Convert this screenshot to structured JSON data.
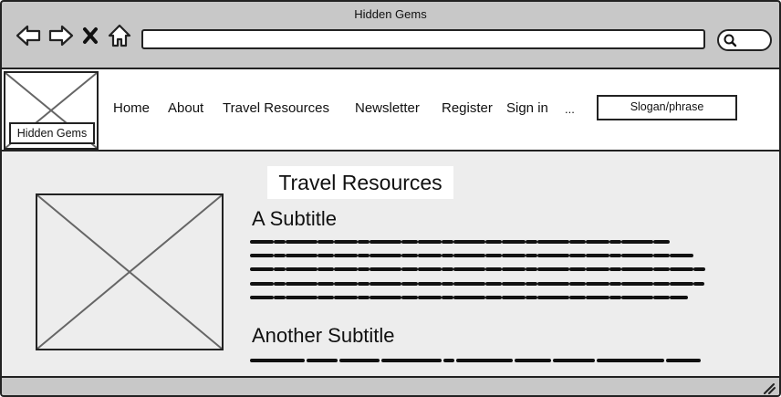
{
  "window": {
    "title": "Hidden Gems"
  },
  "toolbar": {
    "icons": [
      "back-arrow-icon",
      "forward-arrow-icon",
      "close-x-icon",
      "home-icon",
      "search-icon"
    ],
    "url_value": ""
  },
  "site": {
    "logo_label": "Hidden Gems",
    "nav": [
      {
        "label": "Home"
      },
      {
        "label": "About"
      },
      {
        "label": "Travel Resources"
      },
      {
        "label": "Newsletter"
      },
      {
        "label": "Register"
      },
      {
        "label": "Sign in"
      },
      {
        "label": "..."
      }
    ],
    "slogan": "Slogan/phrase"
  },
  "main": {
    "heading": "Travel Resources",
    "sections": [
      {
        "subtitle": "A Subtitle"
      },
      {
        "subtitle": "Another Subtitle"
      }
    ]
  },
  "colors": {
    "chrome": "#c8c8c8",
    "page_bg": "#ededed",
    "ink": "#222222"
  }
}
